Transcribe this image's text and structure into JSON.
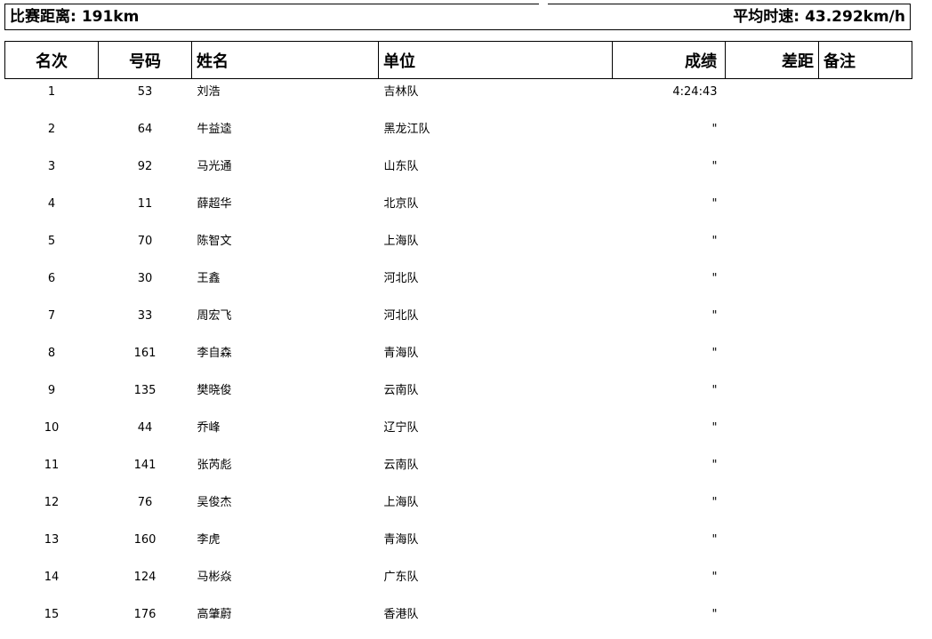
{
  "header": {
    "distance_label": "比赛距离:",
    "distance_value": "191km",
    "speed_label": "平均时速:",
    "speed_value": "43.292km/h"
  },
  "table": {
    "columns": {
      "rank": "名次",
      "bib": "号码",
      "name": "姓名",
      "team": "单位",
      "time": "成绩",
      "gap": "差距",
      "note": "备注"
    },
    "rows": [
      {
        "rank": "1",
        "bib": "53",
        "name": "刘浩",
        "team": "吉林队",
        "time": "4:24:43",
        "gap": "",
        "note": ""
      },
      {
        "rank": "2",
        "bib": "64",
        "name": "牛益逵",
        "team": "黑龙江队",
        "time": "\"",
        "gap": "",
        "note": ""
      },
      {
        "rank": "3",
        "bib": "92",
        "name": "马光通",
        "team": "山东队",
        "time": "\"",
        "gap": "",
        "note": ""
      },
      {
        "rank": "4",
        "bib": "11",
        "name": "薛超华",
        "team": "北京队",
        "time": "\"",
        "gap": "",
        "note": ""
      },
      {
        "rank": "5",
        "bib": "70",
        "name": "陈智文",
        "team": "上海队",
        "time": "\"",
        "gap": "",
        "note": ""
      },
      {
        "rank": "6",
        "bib": "30",
        "name": "王鑫",
        "team": "河北队",
        "time": "\"",
        "gap": "",
        "note": ""
      },
      {
        "rank": "7",
        "bib": "33",
        "name": "周宏飞",
        "team": "河北队",
        "time": "\"",
        "gap": "",
        "note": ""
      },
      {
        "rank": "8",
        "bib": "161",
        "name": "李自森",
        "team": "青海队",
        "time": "\"",
        "gap": "",
        "note": ""
      },
      {
        "rank": "9",
        "bib": "135",
        "name": "樊晓俊",
        "team": "云南队",
        "time": "\"",
        "gap": "",
        "note": ""
      },
      {
        "rank": "10",
        "bib": "44",
        "name": "乔峰",
        "team": "辽宁队",
        "time": "\"",
        "gap": "",
        "note": ""
      },
      {
        "rank": "11",
        "bib": "141",
        "name": "张芮彪",
        "team": "云南队",
        "time": "\"",
        "gap": "",
        "note": ""
      },
      {
        "rank": "12",
        "bib": "76",
        "name": "吴俊杰",
        "team": "上海队",
        "time": "\"",
        "gap": "",
        "note": ""
      },
      {
        "rank": "13",
        "bib": "160",
        "name": "李虎",
        "team": "青海队",
        "time": "\"",
        "gap": "",
        "note": ""
      },
      {
        "rank": "14",
        "bib": "124",
        "name": "马彬焱",
        "team": "广东队",
        "time": "\"",
        "gap": "",
        "note": ""
      },
      {
        "rank": "15",
        "bib": "176",
        "name": "高肇蔚",
        "team": "香港队",
        "time": "\"",
        "gap": "",
        "note": ""
      }
    ]
  }
}
